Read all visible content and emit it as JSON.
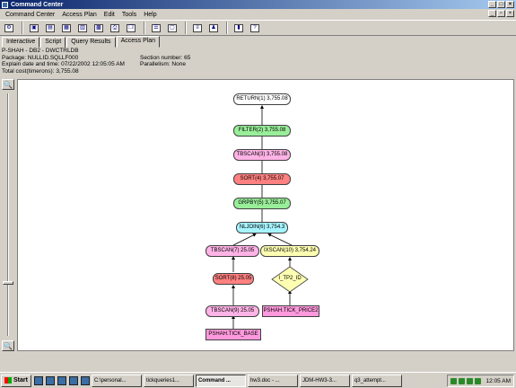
{
  "window": {
    "title": "Command Center"
  },
  "menu": [
    "Command Center",
    "Access Plan",
    "Edit",
    "Tools",
    "Help"
  ],
  "toolbar": {
    "icons": [
      "connect-icon",
      "new-icon",
      "open-icon",
      "save-icon",
      "grid-icon",
      "image-icon",
      "print-icon",
      "copy-icon",
      "list-icon",
      "document-icon",
      "database-icon",
      "tree-icon",
      "book-icon",
      "help-icon"
    ],
    "glyphs": [
      "⚙",
      "▣",
      "▤",
      "▦",
      "▥",
      "▩",
      "⎙",
      "❐",
      "☰",
      "▢",
      "≡",
      "♟",
      "▮",
      "?"
    ]
  },
  "tabs": [
    "Interactive",
    "Script",
    "Query Results",
    "Access Plan"
  ],
  "active_tab": "Access Plan",
  "plan_info": {
    "db": "P-SHAH - DB2 - DWCTRLDB",
    "package": "Package: NULLID.SQLLF000",
    "section": "Section number: 65",
    "explain": "Explain date and time: 07/22/2002 12:05:05 AM",
    "parallelism": "Parallelism: None",
    "total_cost": "Total cost(timerons): 3,755.08"
  },
  "zoom": {
    "in_glyph": "🔍",
    "out_glyph": "🔍"
  },
  "plan_nodes": {
    "return": "RETURN(1) 3,755.08",
    "filter": "FILTER(2) 3,755.08",
    "tbscan3": "TBSCAN(3) 3,755.08",
    "sort4": "SORT(4) 3,755.07",
    "grpby5": "GRPBY(5) 3,755.07",
    "nljoin6": "NLJOIN(6) 3,754.3",
    "tbscan7": "TBSCAN(7) 25.05",
    "ixscan10": "IXSCAN(10) 3,754.24",
    "sort8": "SORT(8) 25.05",
    "index": "I_TP2_ID",
    "tbscan9": "TBSCAN(9) 25.05",
    "table_price": "PSHAH.TICK_PRICE2",
    "table_base": "PSHAH.TICK_BASE"
  },
  "taskbar": {
    "start": "Start",
    "buttons": [
      "C:\\personal...",
      "tickqueries1...",
      "Command ...",
      "hw3.doc - ...",
      "JDM-HW3-3...",
      "q3_attempt..."
    ],
    "active_index": 2,
    "clock": "12:05 AM"
  }
}
